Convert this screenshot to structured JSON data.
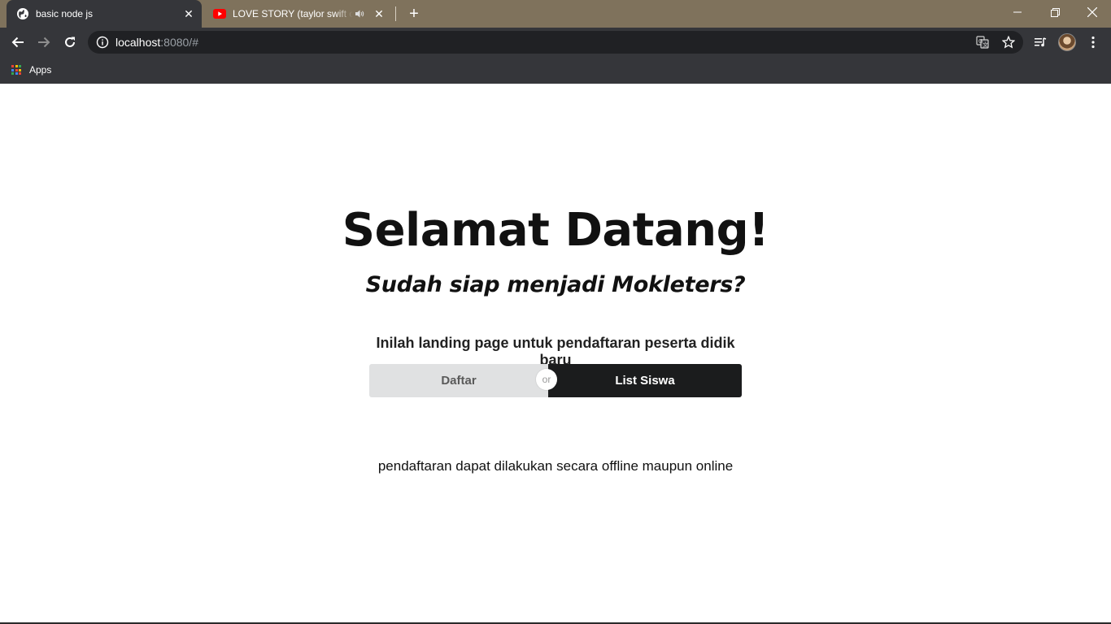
{
  "tabs": [
    {
      "title": "basic node js",
      "active": true,
      "favicon": "globe-icon"
    },
    {
      "title": "LOVE STORY (taylor swift cov",
      "active": false,
      "favicon": "youtube-icon",
      "audio": "speaker-icon"
    }
  ],
  "toolbar": {
    "url_host": "localhost",
    "url_rest": ":8080/#"
  },
  "bookmarks": {
    "apps_label": "Apps"
  },
  "page": {
    "title": "Selamat Datang!",
    "subtitle": "Sudah siap menjadi Mokleters?",
    "intro": "Inilah landing page untuk pendaftaran peserta didik baru",
    "buttons": {
      "left_label": "Daftar",
      "or_label": "or",
      "right_label": "List Siswa"
    },
    "note": "pendaftaran dapat dilakukan secara offline maupun online"
  },
  "colors": {
    "tabstrip": "#7f725c",
    "toolbar": "#35363a",
    "button_light": "#e0e1e2",
    "button_dark": "#1b1c1d",
    "youtube_red": "#ff0000"
  }
}
